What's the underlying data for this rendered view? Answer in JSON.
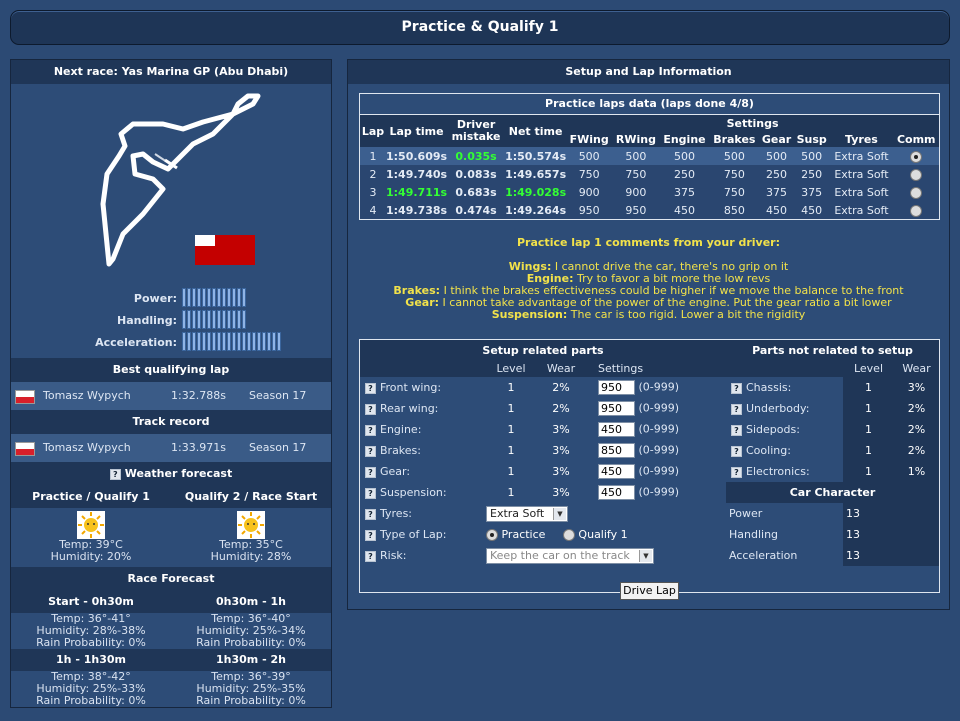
{
  "window": {
    "title": "Practice & Qualify 1"
  },
  "left": {
    "next_race": "Next race: Yas Marina GP (Abu Dhabi)",
    "stats": [
      {
        "label": "Power:",
        "level": 13
      },
      {
        "label": "Handling:",
        "level": 13
      },
      {
        "label": "Acceleration:",
        "level": 13
      }
    ],
    "best_lap": {
      "heading": "Best qualifying lap",
      "driver": "Tomasz Wypych",
      "time": "1:32.788s",
      "season": "Season 17"
    },
    "track_record": {
      "heading": "Track record",
      "driver": "Tomasz Wypych",
      "time": "1:33.971s",
      "season": "Season 17"
    },
    "weather": {
      "heading": "Weather forecast",
      "cols": [
        {
          "label": "Practice / Qualify 1",
          "temp": "Temp: 39°C",
          "humidity": "Humidity: 20%",
          "icon": "sunny-icon"
        },
        {
          "label": "Qualify 2 / Race Start",
          "temp": "Temp: 35°C",
          "humidity": "Humidity: 28%",
          "icon": "sunny-icon"
        }
      ]
    },
    "race_forecast": {
      "heading": "Race Forecast",
      "blocks": [
        {
          "label": "Start - 0h30m",
          "temp": "Temp: 36°-41°",
          "humidity": "Humidity: 28%-38%",
          "rain": "Rain Probability: 0%"
        },
        {
          "label": "0h30m - 1h",
          "temp": "Temp: 36°-40°",
          "humidity": "Humidity: 25%-34%",
          "rain": "Rain Probability: 0%"
        },
        {
          "label": "1h - 1h30m",
          "temp": "Temp: 38°-42°",
          "humidity": "Humidity: 25%-33%",
          "rain": "Rain Probability: 0%"
        },
        {
          "label": "1h30m - 2h",
          "temp": "Temp: 36°-39°",
          "humidity": "Humidity: 25%-35%",
          "rain": "Rain Probability: 0%"
        }
      ]
    }
  },
  "right": {
    "heading": "Setup and Lap Information",
    "practice": {
      "title": "Practice laps data (laps done 4/8)",
      "headers": {
        "lap": "Lap",
        "laptime": "Lap time",
        "mistake": "Driver mistake",
        "net": "Net time",
        "settings": "Settings",
        "fwing": "FWing",
        "rwing": "RWing",
        "engine": "Engine",
        "brakes": "Brakes",
        "gear": "Gear",
        "susp": "Susp",
        "tyres": "Tyres",
        "comm": "Comm"
      },
      "rows": [
        {
          "lap": "1",
          "time": "1:50.609s",
          "mistake": "0.035s",
          "net": "1:50.574s",
          "fwing": "500",
          "rwing": "500",
          "engine": "500",
          "brakes": "500",
          "gear": "500",
          "susp": "500",
          "tyres": "Extra Soft",
          "selected": true
        },
        {
          "lap": "2",
          "time": "1:49.740s",
          "mistake": "0.083s",
          "net": "1:49.657s",
          "fwing": "750",
          "rwing": "750",
          "engine": "250",
          "brakes": "750",
          "gear": "250",
          "susp": "250",
          "tyres": "Extra Soft",
          "selected": false
        },
        {
          "lap": "3",
          "time": "1:49.711s",
          "mistake": "0.683s",
          "net": "1:49.028s",
          "fwing": "900",
          "rwing": "900",
          "engine": "375",
          "brakes": "750",
          "gear": "375",
          "susp": "375",
          "tyres": "Extra Soft",
          "selected": false
        },
        {
          "lap": "4",
          "time": "1:49.738s",
          "mistake": "0.474s",
          "net": "1:49.264s",
          "fwing": "950",
          "rwing": "950",
          "engine": "450",
          "brakes": "850",
          "gear": "450",
          "susp": "450",
          "tyres": "Extra Soft",
          "selected": false
        }
      ]
    },
    "comments": {
      "title": "Practice lap 1 comments from your driver:",
      "items": [
        {
          "key": "Wings:",
          "text": " I cannot drive the car, there's no grip on it"
        },
        {
          "key": "Engine:",
          "text": " Try to favor a bit more the low revs"
        },
        {
          "key": "Brakes:",
          "text": " I think the brakes effectiveness could be higher if we move the balance to the front"
        },
        {
          "key": "Gear:",
          "text": " I cannot take advantage of the power of the engine. Put the gear ratio a bit lower"
        },
        {
          "key": "Suspension:",
          "text": " The car is too rigid. Lower a bit the rigidity"
        }
      ]
    },
    "setup": {
      "left_title": "Setup related parts",
      "right_title": "Parts not related to setup",
      "col_level": "Level",
      "col_wear": "Wear",
      "col_settings": "Settings",
      "parts": [
        {
          "name": "Front wing:",
          "level": "1",
          "wear": "2%",
          "value": "950",
          "range": "(0-999)"
        },
        {
          "name": "Rear wing:",
          "level": "1",
          "wear": "2%",
          "value": "950",
          "range": "(0-999)"
        },
        {
          "name": "Engine:",
          "level": "1",
          "wear": "3%",
          "value": "450",
          "range": "(0-999)"
        },
        {
          "name": "Brakes:",
          "level": "1",
          "wear": "3%",
          "value": "850",
          "range": "(0-999)"
        },
        {
          "name": "Gear:",
          "level": "1",
          "wear": "3%",
          "value": "450",
          "range": "(0-999)"
        },
        {
          "name": "Suspension:",
          "level": "1",
          "wear": "3%",
          "value": "450",
          "range": "(0-999)"
        }
      ],
      "other": [
        {
          "name": "Chassis:",
          "level": "1",
          "wear": "3%"
        },
        {
          "name": "Underbody:",
          "level": "1",
          "wear": "2%"
        },
        {
          "name": "Sidepods:",
          "level": "1",
          "wear": "2%"
        },
        {
          "name": "Cooling:",
          "level": "1",
          "wear": "2%"
        },
        {
          "name": "Electronics:",
          "level": "1",
          "wear": "1%"
        }
      ],
      "tyres_label": "Tyres:",
      "tyres_value": "Extra Soft",
      "type_label": "Type of Lap:",
      "type_opt1": "Practice",
      "type_opt2": "Qualify 1",
      "risk_label": "Risk:",
      "risk_value": "Keep the car on the track",
      "car_char": {
        "title": "Car Character",
        "items": [
          {
            "k": "Power",
            "v": "13"
          },
          {
            "k": "Handling",
            "v": "13"
          },
          {
            "k": "Acceleration",
            "v": "13"
          }
        ]
      }
    },
    "drive_button": "Drive Lap"
  },
  "colors": {
    "green_time": "#33ff33",
    "yellow_comment": "#f2e24a",
    "bg": "#2c4a74",
    "header": "#1f3657"
  }
}
